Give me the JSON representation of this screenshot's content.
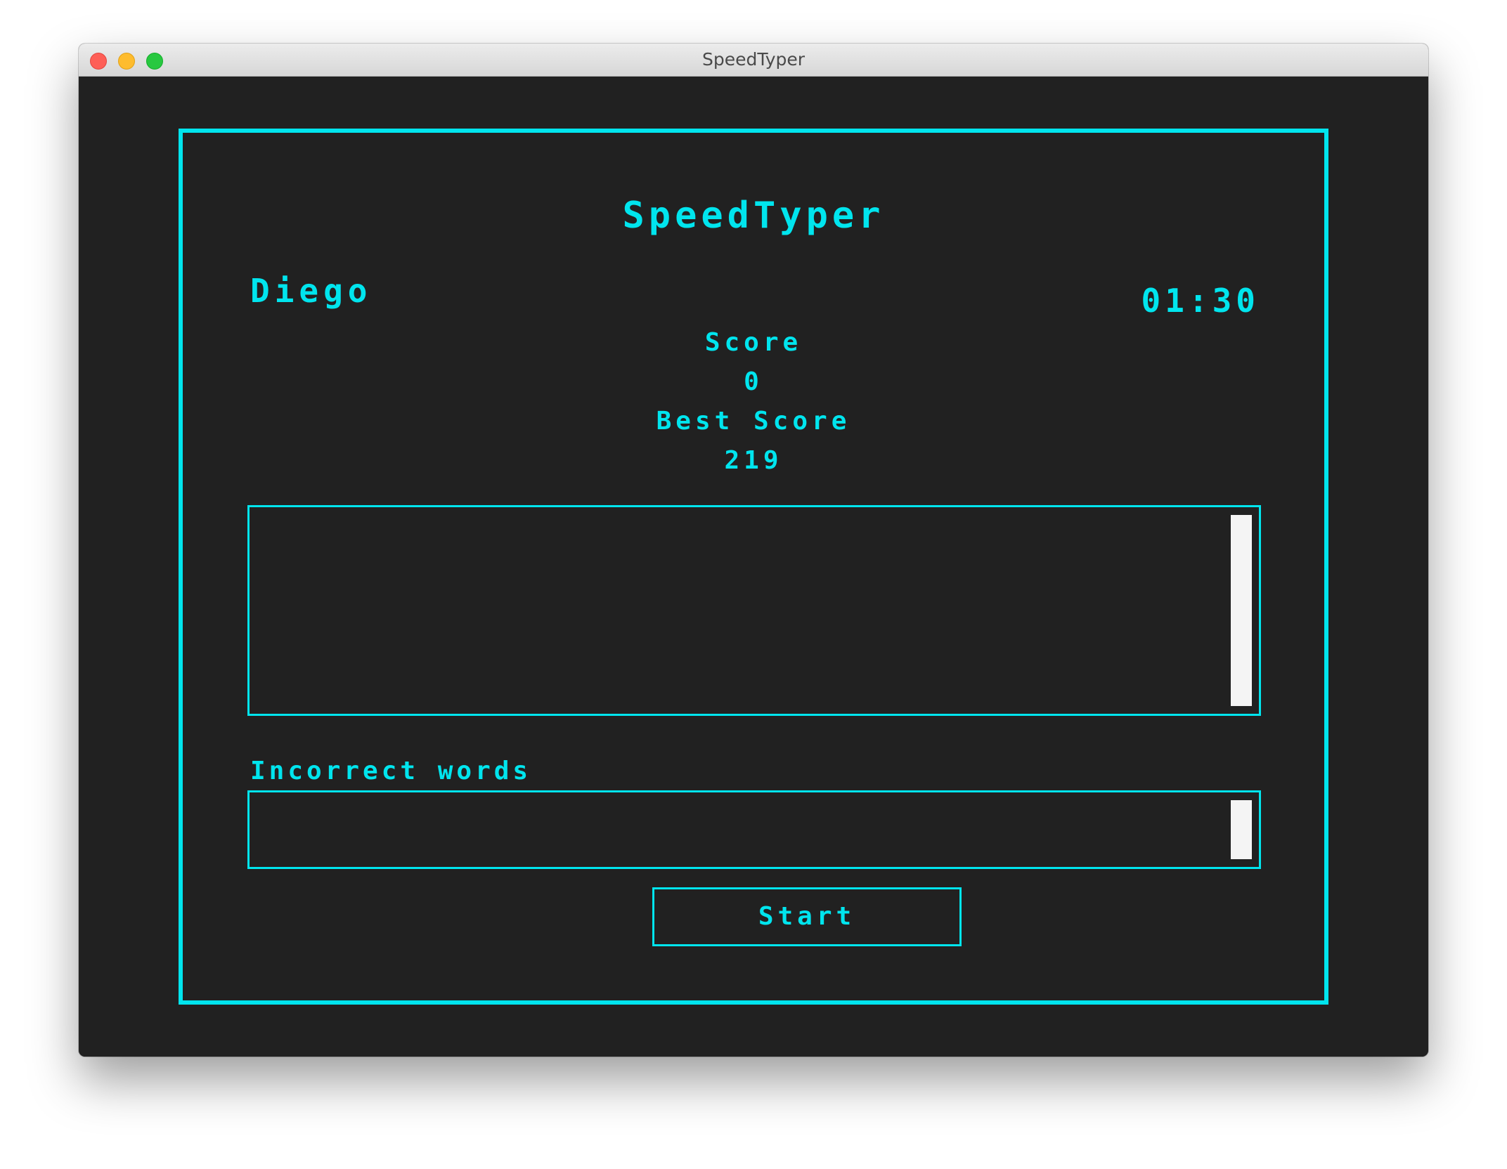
{
  "window": {
    "title": "SpeedTyper",
    "controls": [
      "close",
      "minimize",
      "zoom"
    ]
  },
  "app": {
    "heading": "SpeedTyper",
    "player_name": "Diego",
    "timer": "01:30",
    "score_label": "Score",
    "score_value": "0",
    "best_score_label": "Best Score",
    "best_score_value": "219",
    "typing_area_value": "",
    "incorrect_words_label": "Incorrect words",
    "incorrect_words_value": "",
    "start_label": "Start"
  },
  "colors": {
    "accent": "#00e5ee",
    "background": "#212121",
    "scroll_thumb": "#f4f4f4"
  }
}
